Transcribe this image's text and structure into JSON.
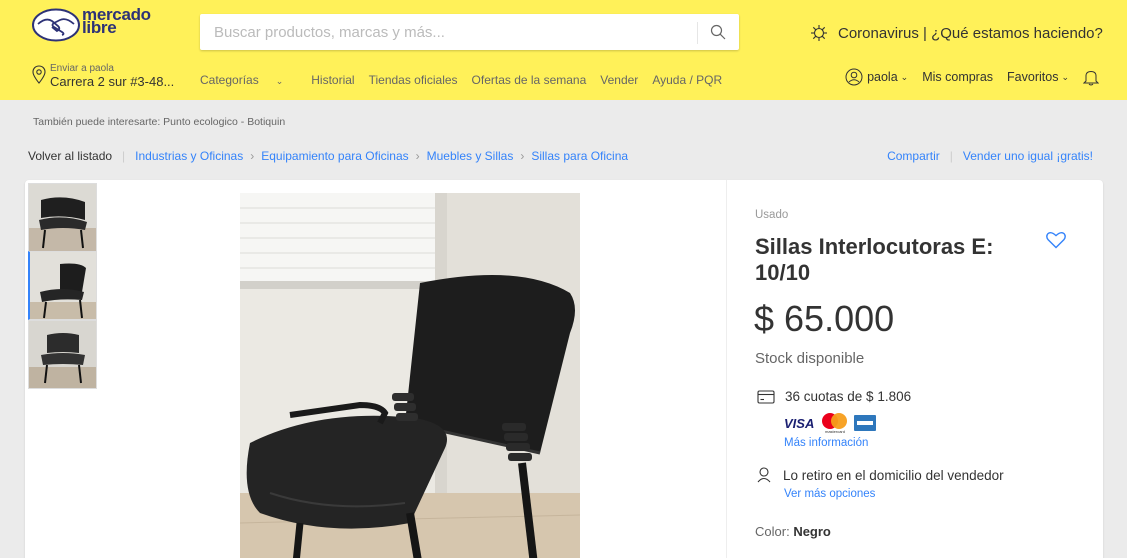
{
  "header": {
    "logo_line1": "mercado",
    "logo_line2": "libre",
    "search_placeholder": "Buscar productos, marcas y más...",
    "covid_text": "Coronavirus | ¿Qué estamos haciendo?",
    "location_small": "Enviar a paola",
    "location_main": "Carrera 2 sur #3-48...",
    "nav": [
      "Categorías",
      "Historial",
      "Tiendas oficiales",
      "Ofertas de la semana",
      "Vender",
      "Ayuda / PQR"
    ],
    "user": "paola",
    "mis_compras": "Mis compras",
    "favoritos": "Favoritos"
  },
  "interest_text": "También puede interesarte: Punto ecologico - Botiquin",
  "breadcrumb": {
    "back": "Volver al listado",
    "items": [
      "Industrias y Oficinas",
      "Equipamiento para Oficinas",
      "Muebles y Sillas",
      "Sillas para Oficina"
    ],
    "share": "Compartir",
    "sell": "Vender uno igual ¡gratis!"
  },
  "product": {
    "condition": "Usado",
    "title": "Sillas Interlocutoras E: 10/10",
    "price": "$ 65.000",
    "stock": "Stock disponible",
    "installments": "36 cuotas de $ 1.806",
    "more_info": "Más información",
    "pickup": "Lo retiro en el domicilio del vendedor",
    "more_options": "Ver más opciones",
    "color_label": "Color:",
    "color_value": "Negro",
    "visa_label": "VISA",
    "mastercard_label": "mastercard"
  },
  "colors": {
    "header_bg": "#fff159",
    "link": "#3483fa",
    "brand": "#2d3277"
  }
}
